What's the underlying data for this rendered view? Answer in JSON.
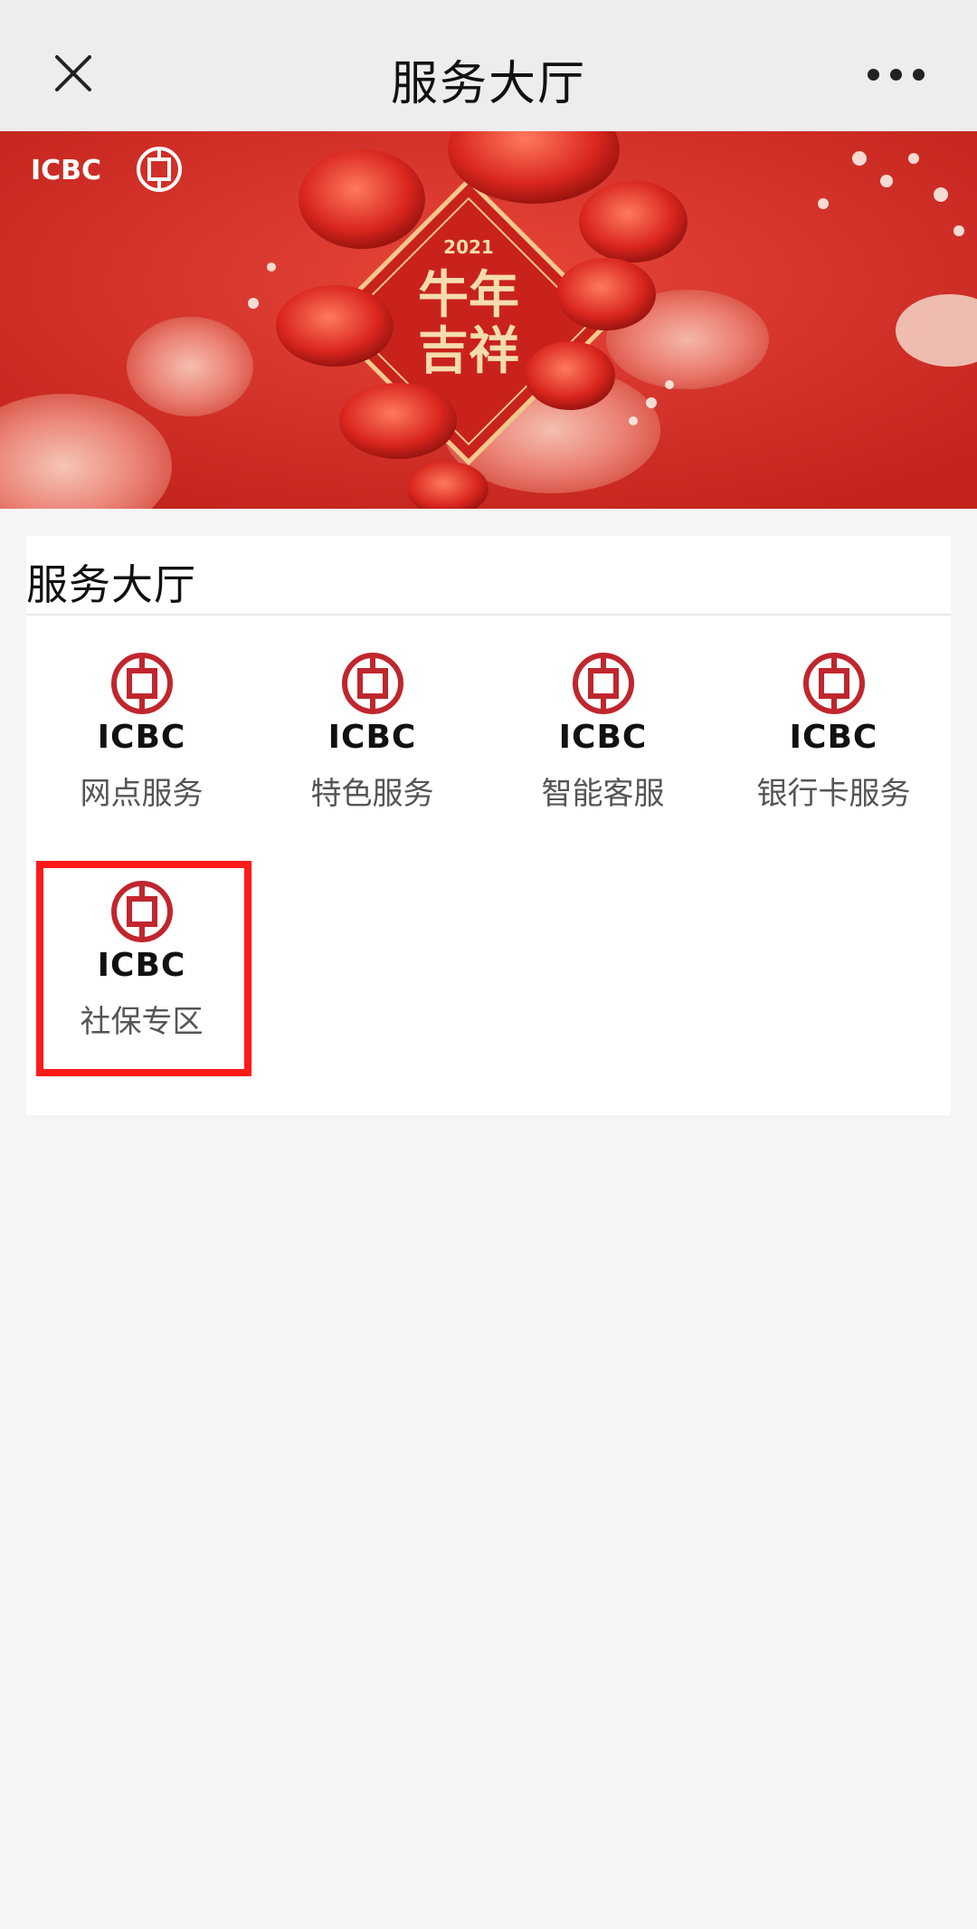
{
  "nav": {
    "title": "服务大厅",
    "close_icon": "close-icon",
    "more_icon": "more-dots-icon"
  },
  "banner": {
    "logo_text": "ICBC",
    "year": "2021",
    "greeting_line1": "牛年",
    "greeting_line2": "吉祥",
    "colors": {
      "background": "#d8322a",
      "accent": "#f3d6a8"
    }
  },
  "section": {
    "title": "服务大厅",
    "items": [
      {
        "brand": "ICBC",
        "label": "网点服务",
        "icon": "icbc-logo-icon"
      },
      {
        "brand": "ICBC",
        "label": "特色服务",
        "icon": "icbc-logo-icon"
      },
      {
        "brand": "ICBC",
        "label": "智能客服",
        "icon": "icbc-logo-icon"
      },
      {
        "brand": "ICBC",
        "label": "银行卡服务",
        "icon": "icbc-logo-icon"
      },
      {
        "brand": "ICBC",
        "label": "社保专区",
        "icon": "icbc-logo-icon"
      }
    ]
  },
  "colors": {
    "brand_red": "#c0262d",
    "highlight": "#ff1a1a"
  }
}
